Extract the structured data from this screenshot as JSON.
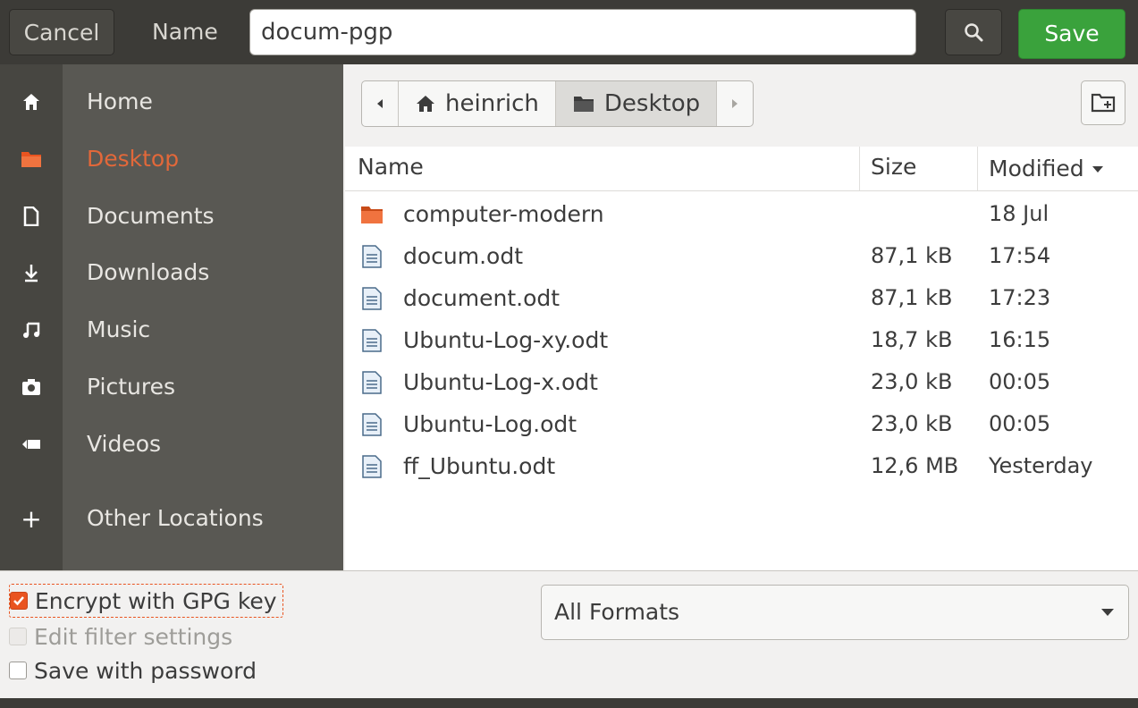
{
  "header": {
    "cancel_label": "Cancel",
    "name_label": "Name",
    "filename_value": "docum-pgp",
    "search_icon": "search-icon",
    "save_label": "Save"
  },
  "sidebar": {
    "items": [
      {
        "label": "Home",
        "icon": "home-icon",
        "active": false
      },
      {
        "label": "Desktop",
        "icon": "folder-icon",
        "active": true
      },
      {
        "label": "Documents",
        "icon": "document-icon",
        "active": false
      },
      {
        "label": "Downloads",
        "icon": "download-icon",
        "active": false
      },
      {
        "label": "Music",
        "icon": "music-icon",
        "active": false
      },
      {
        "label": "Pictures",
        "icon": "camera-icon",
        "active": false
      },
      {
        "label": "Videos",
        "icon": "video-icon",
        "active": false
      },
      {
        "label": "Other Locations",
        "icon": "plus-icon",
        "active": false
      }
    ]
  },
  "pathbar": {
    "segments": [
      "heinrich",
      "Desktop"
    ],
    "current": "Desktop"
  },
  "filelist": {
    "columns": {
      "name": "Name",
      "size": "Size",
      "modified": "Modified"
    },
    "sort_column": "Modified",
    "rows": [
      {
        "name": "computer-modern",
        "size": "",
        "modified": "18 Jul",
        "type": "folder"
      },
      {
        "name": "docum.odt",
        "size": "87,1 kB",
        "modified": "17:54",
        "type": "document"
      },
      {
        "name": "document.odt",
        "size": "87,1 kB",
        "modified": "17:23",
        "type": "document"
      },
      {
        "name": "Ubuntu-Log-xy.odt",
        "size": "18,7 kB",
        "modified": "16:15",
        "type": "document"
      },
      {
        "name": "Ubuntu-Log-x.odt",
        "size": "23,0 kB",
        "modified": "00:05",
        "type": "document"
      },
      {
        "name": "Ubuntu-Log.odt",
        "size": "23,0 kB",
        "modified": "00:05",
        "type": "document"
      },
      {
        "name": "ff_Ubuntu.odt",
        "size": "12,6 MB",
        "modified": "Yesterday",
        "type": "document"
      }
    ]
  },
  "options": {
    "encrypt": {
      "label": "Encrypt with GPG key",
      "checked": true
    },
    "edit_filter": {
      "label": "Edit filter settings",
      "checked": false,
      "disabled": true
    },
    "save_password": {
      "label": "Save with password",
      "checked": false
    },
    "format": "All Formats"
  },
  "colors": {
    "accent": "#e95420",
    "save_green": "#3aa23c",
    "header_bg": "#3c3b37",
    "sidebar_bg": "#595853"
  }
}
